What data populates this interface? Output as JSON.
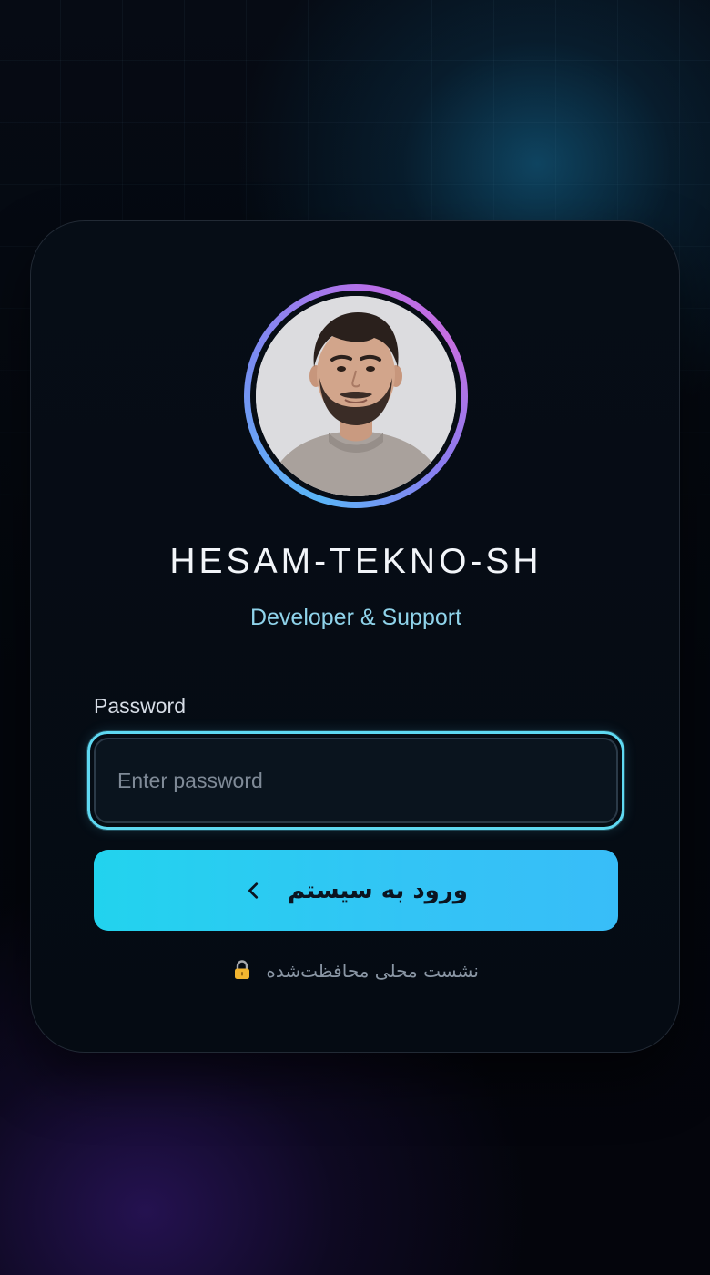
{
  "profile": {
    "name": "HESAM-TEKNO-SH",
    "role": "Developer & Support",
    "avatar_alt": "avatar"
  },
  "form": {
    "password_label": "Password",
    "password_placeholder": "Enter password",
    "password_value": "",
    "submit_label": "ورود به سیستم",
    "submit_icon": "chevron-left-icon"
  },
  "footer": {
    "secure_note": "نشست محلی محافظت‌شده",
    "secure_icon": "lock-icon"
  },
  "colors": {
    "accent": "#22d3ee",
    "accent_end": "#38bdf8",
    "role_text": "#8fd3ea",
    "background": "#03060c",
    "card": "#060d16"
  }
}
